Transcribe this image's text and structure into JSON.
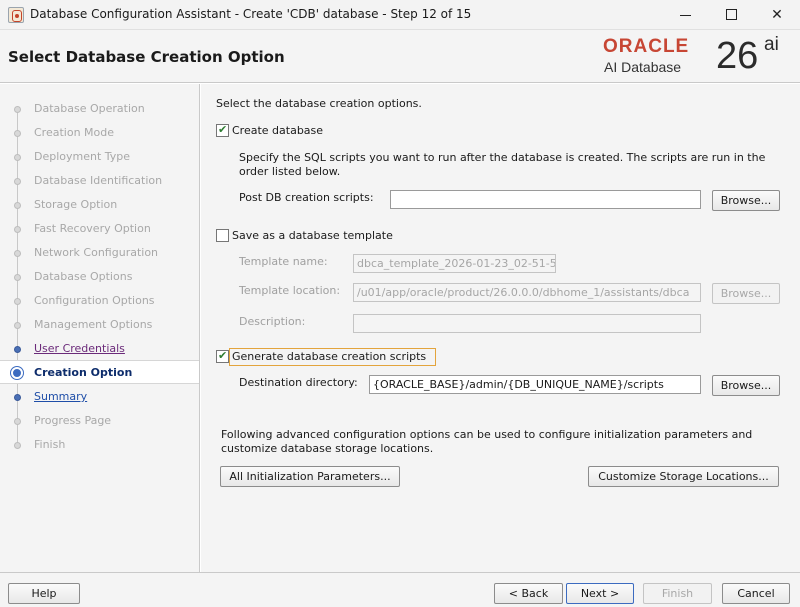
{
  "window": {
    "title": "Database Configuration Assistant - Create 'CDB' database - Step 12 of 15",
    "minimize_glyph": "",
    "maximize_glyph": "",
    "close_glyph": "✕"
  },
  "header": {
    "title": "Select Database Creation Option",
    "logo_brand": "ORACLE",
    "logo_product": "AI Database",
    "logo_version": "26",
    "logo_version_suffix": "ai"
  },
  "nav": {
    "items": [
      {
        "label": "Database Operation",
        "state": "disabled"
      },
      {
        "label": "Creation Mode",
        "state": "disabled"
      },
      {
        "label": "Deployment Type",
        "state": "disabled"
      },
      {
        "label": "Database Identification",
        "state": "disabled"
      },
      {
        "label": "Storage Option",
        "state": "disabled"
      },
      {
        "label": "Fast Recovery Option",
        "state": "disabled"
      },
      {
        "label": "Network Configuration",
        "state": "disabled"
      },
      {
        "label": "Database Options",
        "state": "disabled"
      },
      {
        "label": "Configuration Options",
        "state": "disabled"
      },
      {
        "label": "Management Options",
        "state": "disabled"
      },
      {
        "label": "User Credentials",
        "state": "visited"
      },
      {
        "label": "Creation Option",
        "state": "current"
      },
      {
        "label": "Summary",
        "state": "link"
      },
      {
        "label": "Progress Page",
        "state": "disabled"
      },
      {
        "label": "Finish",
        "state": "disabled"
      }
    ]
  },
  "main": {
    "intro": "Select the database creation options.",
    "create_db": {
      "label": "Create database",
      "checked": true,
      "description": "Specify the SQL scripts you want to run after the database is created. The scripts are run in the order listed below.",
      "post_scripts_label": "Post DB creation scripts:",
      "post_scripts_value": "",
      "browse_label": "Browse..."
    },
    "template": {
      "label": "Save as a database template",
      "checked": false,
      "name_label": "Template name:",
      "name_value": "dbca_template_2026-01-23_02-51-5",
      "location_label": "Template location:",
      "location_value": "/u01/app/oracle/product/26.0.0.0/dbhome_1/assistants/dbca",
      "browse_label": "Browse...",
      "description_label": "Description:",
      "description_value": ""
    },
    "gen_scripts": {
      "label": "Generate database creation scripts",
      "checked": true,
      "dest_label": "Destination directory:",
      "dest_value": "{ORACLE_BASE}/admin/{DB_UNIQUE_NAME}/scripts",
      "browse_label": "Browse..."
    },
    "advanced": {
      "text": "Following advanced configuration options can be used to configure initialization parameters and customize database storage locations.",
      "init_params_label": "All Initialization Parameters...",
      "storage_label": "Customize Storage Locations..."
    }
  },
  "footer": {
    "help": "Help",
    "back": "< Back",
    "next": "Next >",
    "finish": "Finish",
    "cancel": "Cancel"
  }
}
